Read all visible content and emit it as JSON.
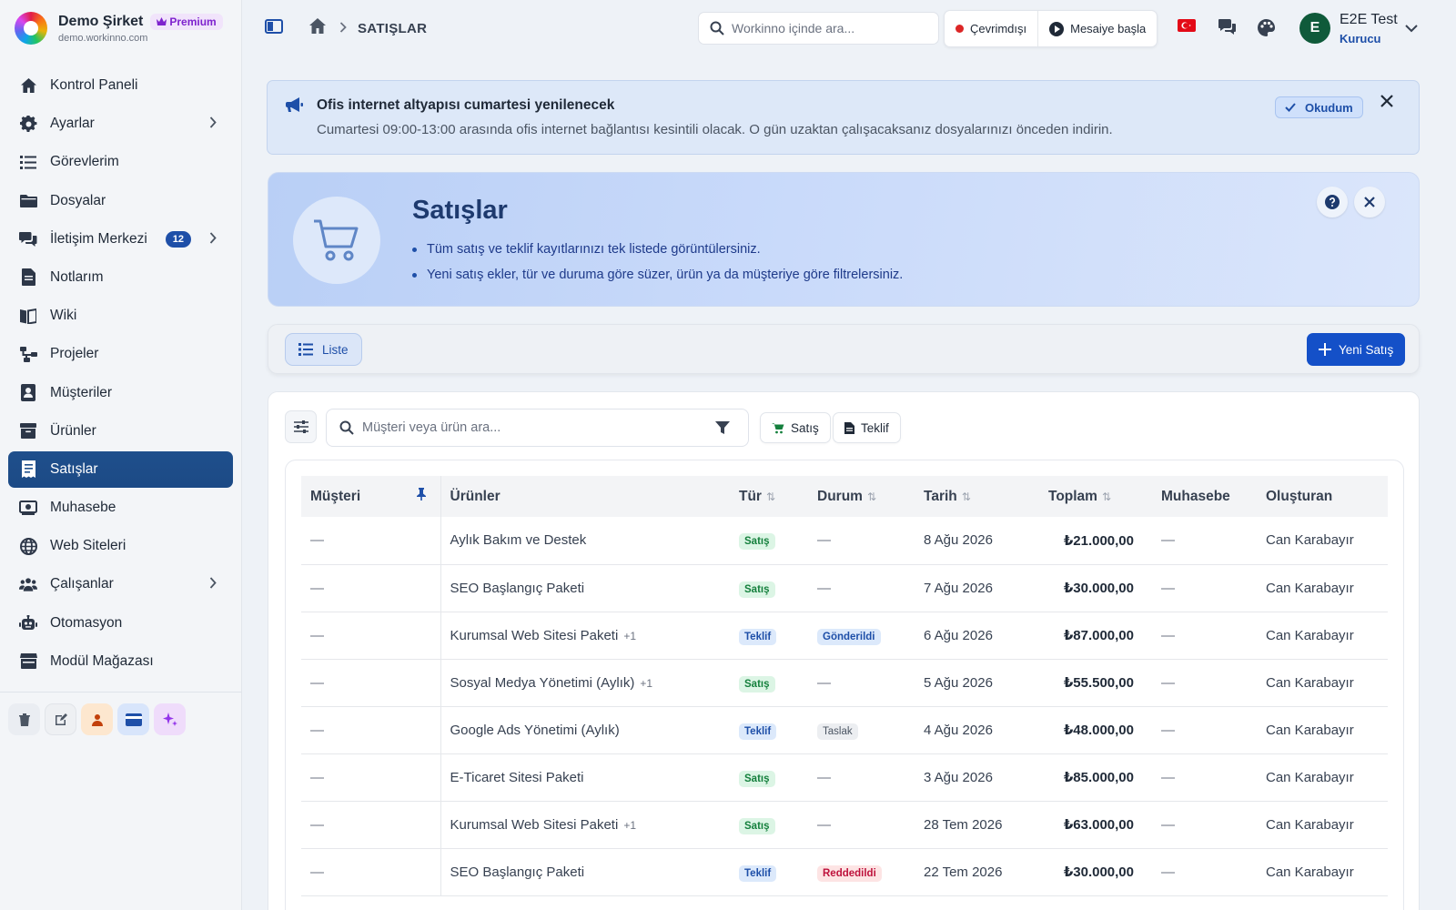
{
  "brand": {
    "name": "Demo Şirket",
    "badge": "Premium",
    "domain": "demo.workinno.com"
  },
  "sidebar": {
    "items": [
      {
        "label": "Kontrol Paneli",
        "icon": "home-icon",
        "active": false
      },
      {
        "label": "Ayarlar",
        "icon": "gear-icon",
        "chevron": true
      },
      {
        "label": "Görevlerim",
        "icon": "task-list-icon"
      },
      {
        "label": "Dosyalar",
        "icon": "folder-icon"
      },
      {
        "label": "İletişim Merkezi",
        "icon": "chat-icon",
        "badge": "12",
        "chevron": true
      },
      {
        "label": "Notlarım",
        "icon": "note-icon"
      },
      {
        "label": "Wiki",
        "icon": "book-icon"
      },
      {
        "label": "Projeler",
        "icon": "project-icon"
      },
      {
        "label": "Müşteriler",
        "icon": "contact-icon"
      },
      {
        "label": "Ürünler",
        "icon": "box-icon"
      },
      {
        "label": "Satışlar",
        "icon": "receipt-icon",
        "active": true
      },
      {
        "label": "Muhasebe",
        "icon": "accounting-icon"
      },
      {
        "label": "Web Siteleri",
        "icon": "globe-icon"
      },
      {
        "label": "Çalışanlar",
        "icon": "users-icon",
        "chevron": true
      },
      {
        "label": "Otomasyon",
        "icon": "robot-icon"
      },
      {
        "label": "Modül Mağazası",
        "icon": "store-icon"
      }
    ],
    "tools": [
      "trash-icon",
      "edit-icon",
      "person-icon",
      "card-icon",
      "sparkle-icon"
    ]
  },
  "header": {
    "breadcrumb_title": "SATIŞLAR",
    "search_placeholder": "Workinno içinde ara...",
    "status_label": "Çevrimdışı",
    "shift_label": "Mesaiye başla",
    "user_initial": "E",
    "user_name": "E2E Test",
    "user_role": "Kurucu"
  },
  "announcement": {
    "title": "Ofis internet altyapısı cumartesi yenilenecek",
    "text": "Cumartesi 09:00-13:00 arasında ofis internet bağlantısı kesintili olacak. O gün uzaktan çalışacaksanız dosyalarınızı önceden indirin.",
    "ack_label": "Okudum"
  },
  "hero": {
    "title": "Satışlar",
    "bullets": [
      "Tüm satış ve teklif kayıtlarınızı tek listede görüntülersiniz.",
      "Yeni satış ekler, tür ve duruma göre süzer, ürün ya da müşteriye göre filtrelersiniz."
    ]
  },
  "toolbar": {
    "list_label": "Liste",
    "new_label": "Yeni Satış"
  },
  "filters": {
    "search_placeholder": "Müşteri veya ürün ara...",
    "chip_satis": "Satış",
    "chip_teklif": "Teklif"
  },
  "table": {
    "headers": {
      "customer": "Müşteri",
      "products": "Ürünler",
      "type": "Tür",
      "status": "Durum",
      "date": "Tarih",
      "total": "Toplam",
      "accounting": "Muhasebe",
      "creator": "Oluşturan"
    },
    "rows": [
      {
        "customer": "—",
        "product": "Aylık Bakım ve Destek",
        "more": "",
        "type": "Satış",
        "status": "—",
        "date": "8 Ağu 2026",
        "total": "₺21.000,00",
        "accounting": "—",
        "creator": "Can Karabayır"
      },
      {
        "customer": "—",
        "product": "SEO Başlangıç Paketi",
        "more": "",
        "type": "Satış",
        "status": "—",
        "date": "7 Ağu 2026",
        "total": "₺30.000,00",
        "accounting": "—",
        "creator": "Can Karabayır"
      },
      {
        "customer": "—",
        "product": "Kurumsal Web Sitesi Paketi",
        "more": "+1",
        "type": "Teklif",
        "status": "Gönderildi",
        "date": "6 Ağu 2026",
        "total": "₺87.000,00",
        "accounting": "—",
        "creator": "Can Karabayır"
      },
      {
        "customer": "—",
        "product": "Sosyal Medya Yönetimi (Aylık)",
        "more": "+1",
        "type": "Satış",
        "status": "—",
        "date": "5 Ağu 2026",
        "total": "₺55.500,00",
        "accounting": "—",
        "creator": "Can Karabayır"
      },
      {
        "customer": "—",
        "product": "Google Ads Yönetimi (Aylık)",
        "more": "",
        "type": "Teklif",
        "status": "Taslak",
        "date": "4 Ağu 2026",
        "total": "₺48.000,00",
        "accounting": "—",
        "creator": "Can Karabayır"
      },
      {
        "customer": "—",
        "product": "E-Ticaret Sitesi Paketi",
        "more": "",
        "type": "Satış",
        "status": "—",
        "date": "3 Ağu 2026",
        "total": "₺85.000,00",
        "accounting": "—",
        "creator": "Can Karabayır"
      },
      {
        "customer": "—",
        "product": "Kurumsal Web Sitesi Paketi",
        "more": "+1",
        "type": "Satış",
        "status": "—",
        "date": "28 Tem 2026",
        "total": "₺63.000,00",
        "accounting": "—",
        "creator": "Can Karabayır"
      },
      {
        "customer": "—",
        "product": "SEO Başlangıç Paketi",
        "more": "",
        "type": "Teklif",
        "status": "Reddedildi",
        "date": "22 Tem 2026",
        "total": "₺30.000,00",
        "accounting": "—",
        "creator": "Can Karabayır"
      }
    ]
  },
  "colors": {
    "accent": "#1e4fa8",
    "active_nav": "#1f4f8c",
    "primary_button": "#1450c8",
    "status_offline": "#dc2626"
  }
}
